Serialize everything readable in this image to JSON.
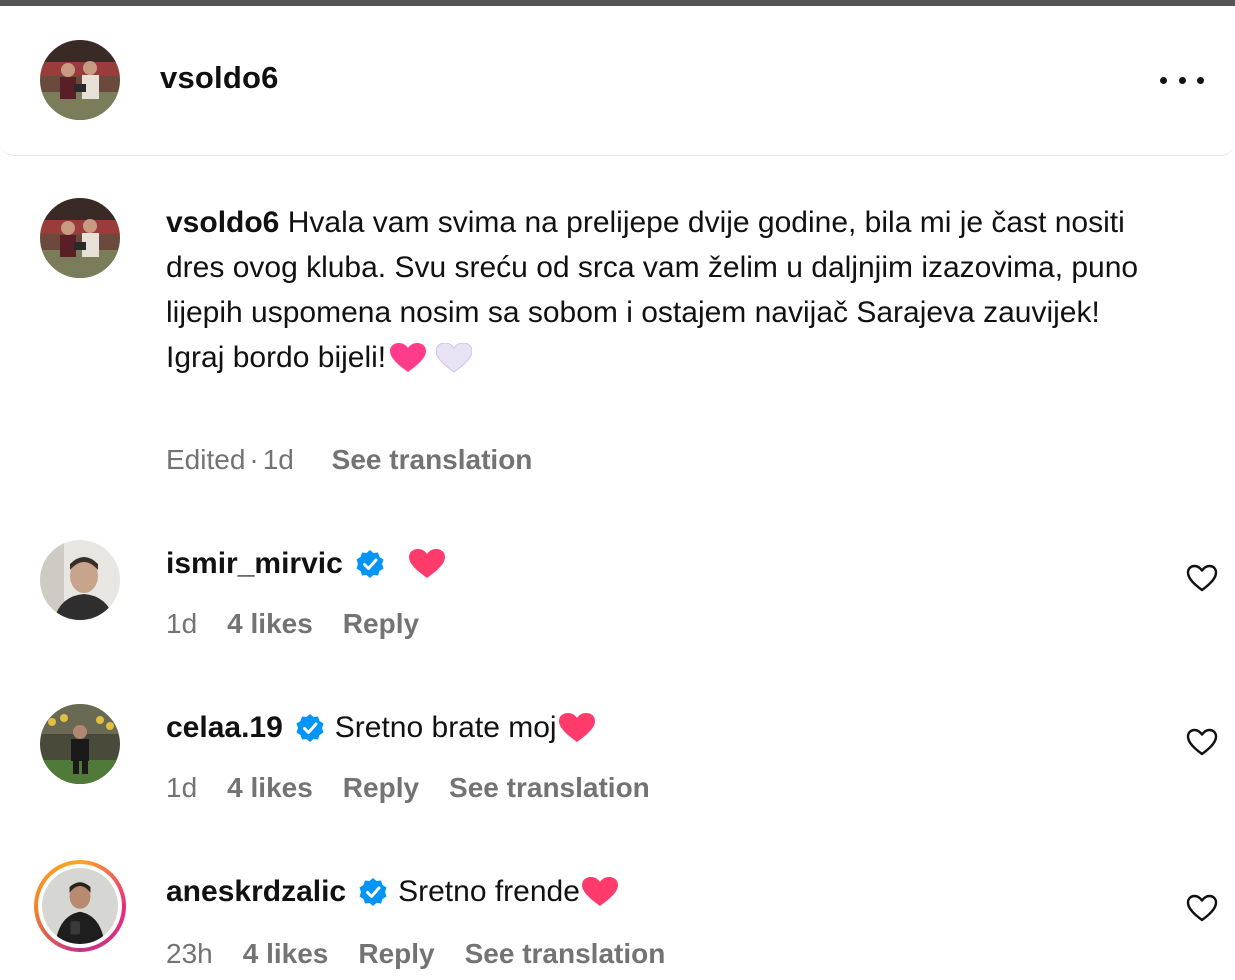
{
  "post": {
    "username": "vsoldo6",
    "more_icon": "more-horizontal-icon"
  },
  "caption": {
    "username": "vsoldo6",
    "text": "Hvala vam svima na prelijepe dvije godine, bila mi je čast nositi dres ovog kluba. Svu sreću od srca vam želim u daljnjim izazovima, puno lijepih uspomena nosim sa sobom i ostajem navijač Sarajeva zauvijek!",
    "text2": "Igraj bordo bijeli!",
    "edited": "Edited",
    "time": "1d",
    "see_translation": "See translation"
  },
  "comments": [
    {
      "username": "ismir_mirvic",
      "verified": true,
      "text": "",
      "emoji": "red-heart",
      "time": "1d",
      "likes": "4 likes",
      "reply": "Reply"
    },
    {
      "username": "celaa.19",
      "verified": true,
      "text": "Sretno brate moj",
      "emoji": "red-heart",
      "time": "1d",
      "likes": "4 likes",
      "reply": "Reply",
      "see_translation": "See translation"
    },
    {
      "username": "aneskrdzalic",
      "verified": true,
      "story_ring": true,
      "text": "Sretno frende",
      "emoji": "red-heart",
      "time": "23h",
      "likes": "4 likes",
      "reply": "Reply",
      "see_translation": "See translation"
    }
  ],
  "colors": {
    "verified": "#0095f6",
    "heart": "#ff3b6b",
    "muted": "#737373"
  }
}
